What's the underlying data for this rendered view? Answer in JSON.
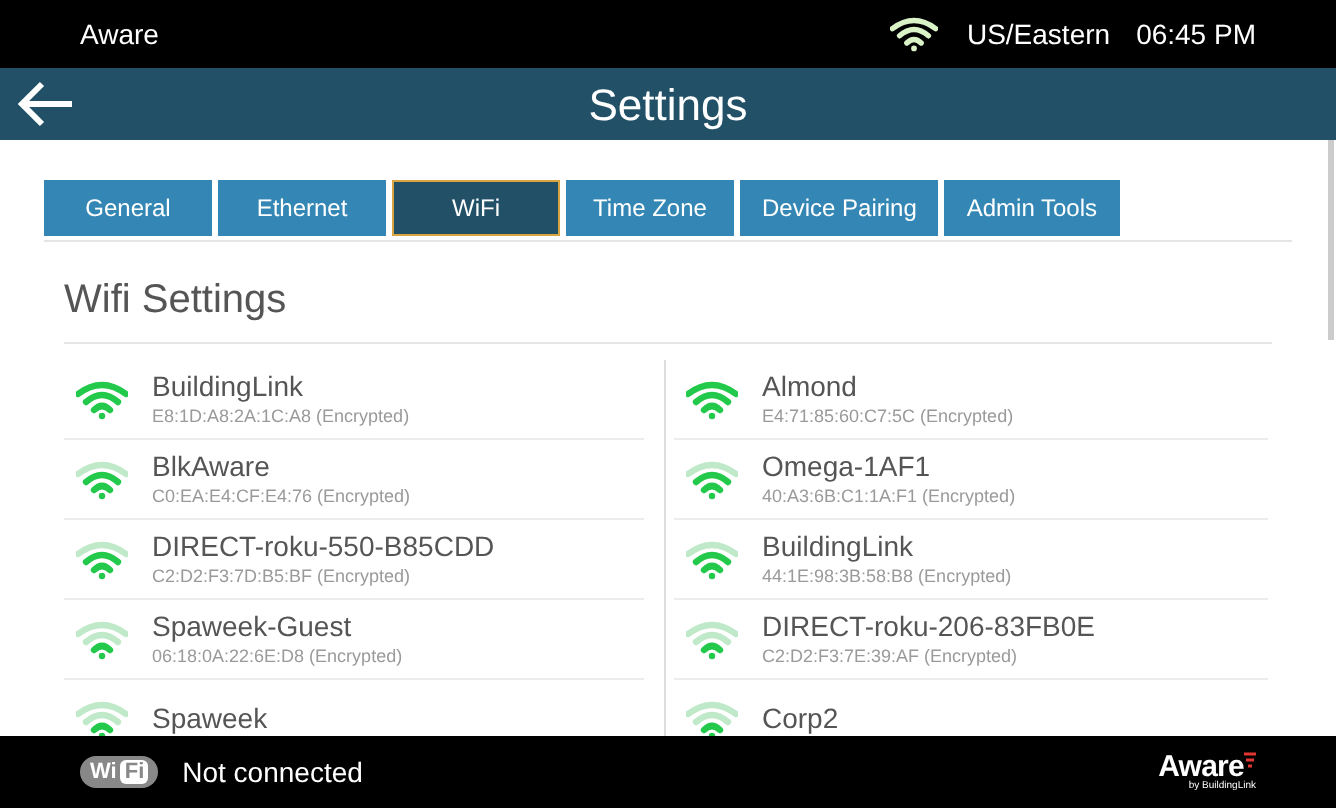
{
  "status_bar": {
    "app_name": "Aware",
    "timezone": "US/Eastern",
    "time": "06:45 PM"
  },
  "header": {
    "title": "Settings"
  },
  "tabs": [
    {
      "label": "General",
      "selected": false
    },
    {
      "label": "Ethernet",
      "selected": false
    },
    {
      "label": "WiFi",
      "selected": true
    },
    {
      "label": "Time Zone",
      "selected": false
    },
    {
      "label": "Device Pairing",
      "selected": false
    },
    {
      "label": "Admin Tools",
      "selected": false
    }
  ],
  "section_title": "Wifi Settings",
  "networks": [
    [
      {
        "name": "BuildingLink",
        "detail": "E8:1D:A8:2A:1C:A8 (Encrypted)",
        "kind": "strong"
      },
      {
        "name": "BlkAware",
        "detail": "C0:EA:E4:CF:E4:76 (Encrypted)",
        "kind": "good"
      },
      {
        "name": "DIRECT-roku-550-B85CDD",
        "detail": "C2:D2:F3:7D:B5:BF (Encrypted)",
        "kind": "good"
      },
      {
        "name": "Spaweek-Guest",
        "detail": "06:18:0A:22:6E:D8 (Encrypted)",
        "kind": "weak"
      },
      {
        "name": "Spaweek",
        "kind": "weak"
      }
    ],
    [
      {
        "name": "Almond",
        "detail": "E4:71:85:60:C7:5C (Encrypted)",
        "kind": "strong"
      },
      {
        "name": "Omega-1AF1",
        "detail": "40:A3:6B:C1:1A:F1 (Encrypted)",
        "kind": "good"
      },
      {
        "name": "BuildingLink",
        "detail": "44:1E:98:3B:58:B8 (Encrypted)",
        "kind": "good"
      },
      {
        "name": "DIRECT-roku-206-83FB0E",
        "detail": "C2:D2:F3:7E:39:AF (Encrypted)",
        "kind": "weak"
      },
      {
        "name": "Corp2",
        "kind": "weak"
      }
    ]
  ],
  "footer": {
    "badge_left": "Wi",
    "badge_right": "Fi",
    "connection": "Not connected",
    "logo": "Aware",
    "logo_sub": "by BuildingLink"
  }
}
